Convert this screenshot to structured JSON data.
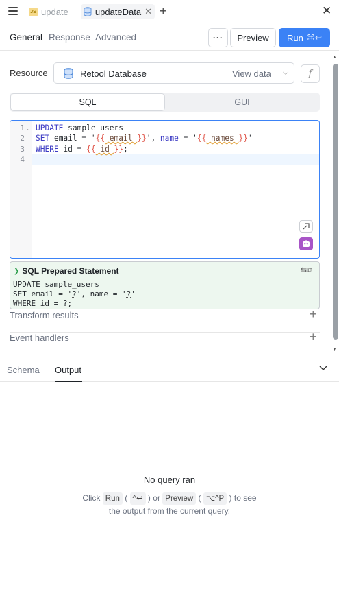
{
  "tabs": [
    {
      "label": "update",
      "icon": "js-icon",
      "active": false
    },
    {
      "label": "updateData",
      "icon": "database-icon",
      "active": true
    }
  ],
  "subnav": {
    "tabs": [
      "General",
      "Response",
      "Advanced"
    ],
    "active_tab": "General",
    "more_label": "···",
    "preview_label": "Preview",
    "run_label": "Run",
    "run_shortcut": "⌘↩"
  },
  "resource": {
    "label": "Resource",
    "name": "Retool Database",
    "view_data_label": "View data",
    "fx_label": "f"
  },
  "mode": {
    "options": [
      "SQL",
      "GUI"
    ],
    "selected": "SQL"
  },
  "editor": {
    "line_numbers": [
      "1",
      "2",
      "3",
      "4"
    ],
    "line1": {
      "kw1": "UPDATE",
      "rest": " sample_users"
    },
    "line2": {
      "kw1": "SET",
      "t1": " email = '",
      "o1": "{{",
      "v1": " email ",
      "c1": "}}",
      "t2": "', ",
      "kw2": "name",
      "t3": " = '",
      "o2": "{{",
      "v2": " names ",
      "c2": "}}",
      "t4": "'"
    },
    "line3": {
      "kw1": "WHERE",
      "t1": " id = ",
      "o1": "{{",
      "v1": " id ",
      "c1": "}}",
      "t2": ";"
    },
    "line4": ""
  },
  "prepared": {
    "title": "SQL Prepared Statement",
    "line1": "UPDATE sample_users",
    "line2a": "SET email = '",
    "line2q1": "?",
    "line2b": "', name = '",
    "line2q2": "?",
    "line2c": "'",
    "line3a": "WHERE id = ",
    "line3q": "?",
    "line3b": ";"
  },
  "sections": [
    "Transform results",
    "Event handlers"
  ],
  "bottom": {
    "tabs": [
      "Schema",
      "Output"
    ],
    "active_tab": "Output",
    "empty_title": "No query ran",
    "desc_click": "Click",
    "run_kbd": "Run",
    "run_shortcut": "^↩",
    "or": "or",
    "preview_kbd": "Preview",
    "preview_shortcut": "⌥^P",
    "to_see": "to see",
    "desc_line2": "the output from the current query."
  },
  "colors": {
    "accent": "#3b82f6",
    "ai_button": "#a855c7",
    "prepared_bg": "#edf7ef"
  }
}
